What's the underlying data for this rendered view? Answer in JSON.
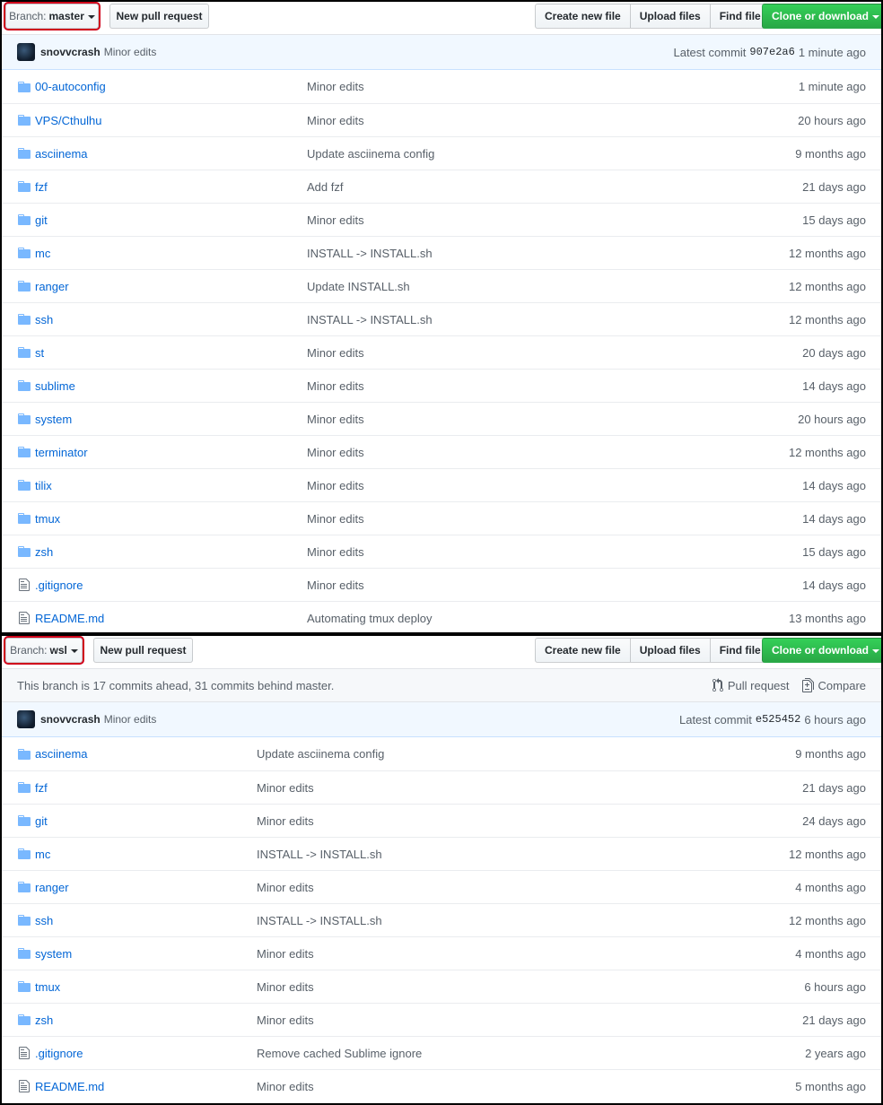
{
  "master": {
    "branch_label": "Branch:",
    "branch_value": "master",
    "new_pr": "New pull request",
    "create_file": "Create new file",
    "upload_files": "Upload files",
    "find_file": "Find file",
    "clone": "Clone or download",
    "commit": {
      "author": "snovvcrash",
      "message": "Minor edits",
      "latest_label": "Latest commit",
      "sha": "907e2a6",
      "time": "1 minute ago"
    },
    "rows": [
      {
        "type": "dir",
        "name": "00-autoconfig",
        "msg": "Minor edits",
        "age": "1 minute ago"
      },
      {
        "type": "dir",
        "name": "VPS/Cthulhu",
        "msg": "Minor edits",
        "age": "20 hours ago"
      },
      {
        "type": "dir",
        "name": "asciinema",
        "msg": "Update asciinema config",
        "age": "9 months ago"
      },
      {
        "type": "dir",
        "name": "fzf",
        "msg": "Add fzf",
        "age": "21 days ago"
      },
      {
        "type": "dir",
        "name": "git",
        "msg": "Minor edits",
        "age": "15 days ago"
      },
      {
        "type": "dir",
        "name": "mc",
        "msg": "INSTALL -> INSTALL.sh",
        "age": "12 months ago"
      },
      {
        "type": "dir",
        "name": "ranger",
        "msg": "Update INSTALL.sh",
        "age": "12 months ago"
      },
      {
        "type": "dir",
        "name": "ssh",
        "msg": "INSTALL -> INSTALL.sh",
        "age": "12 months ago"
      },
      {
        "type": "dir",
        "name": "st",
        "msg": "Minor edits",
        "age": "20 days ago"
      },
      {
        "type": "dir",
        "name": "sublime",
        "msg": "Minor edits",
        "age": "14 days ago"
      },
      {
        "type": "dir",
        "name": "system",
        "msg": "Minor edits",
        "age": "20 hours ago"
      },
      {
        "type": "dir",
        "name": "terminator",
        "msg": "Minor edits",
        "age": "12 months ago"
      },
      {
        "type": "dir",
        "name": "tilix",
        "msg": "Minor edits",
        "age": "14 days ago"
      },
      {
        "type": "dir",
        "name": "tmux",
        "msg": "Minor edits",
        "age": "14 days ago"
      },
      {
        "type": "dir",
        "name": "zsh",
        "msg": "Minor edits",
        "age": "15 days ago"
      },
      {
        "type": "file",
        "name": ".gitignore",
        "msg": "Minor edits",
        "age": "14 days ago"
      },
      {
        "type": "file",
        "name": "README.md",
        "msg": "Automating tmux deploy",
        "age": "13 months ago"
      }
    ]
  },
  "wsl": {
    "branch_label": "Branch:",
    "branch_value": "wsl",
    "new_pr": "New pull request",
    "create_file": "Create new file",
    "upload_files": "Upload files",
    "find_file": "Find file",
    "clone": "Clone or download",
    "branch_status": "This branch is 17 commits ahead, 31 commits behind master.",
    "pull_request": "Pull request",
    "compare": "Compare",
    "commit": {
      "author": "snovvcrash",
      "message": "Minor edits",
      "latest_label": "Latest commit",
      "sha": "e525452",
      "time": "6 hours ago"
    },
    "rows": [
      {
        "type": "dir",
        "name": "asciinema",
        "msg": "Update asciinema config",
        "age": "9 months ago"
      },
      {
        "type": "dir",
        "name": "fzf",
        "msg": "Minor edits",
        "age": "21 days ago"
      },
      {
        "type": "dir",
        "name": "git",
        "msg": "Minor edits",
        "age": "24 days ago"
      },
      {
        "type": "dir",
        "name": "mc",
        "msg": "INSTALL -> INSTALL.sh",
        "age": "12 months ago"
      },
      {
        "type": "dir",
        "name": "ranger",
        "msg": "Minor edits",
        "age": "4 months ago"
      },
      {
        "type": "dir",
        "name": "ssh",
        "msg": "INSTALL -> INSTALL.sh",
        "age": "12 months ago"
      },
      {
        "type": "dir",
        "name": "system",
        "msg": "Minor edits",
        "age": "4 months ago"
      },
      {
        "type": "dir",
        "name": "tmux",
        "msg": "Minor edits",
        "age": "6 hours ago"
      },
      {
        "type": "dir",
        "name": "zsh",
        "msg": "Minor edits",
        "age": "21 days ago"
      },
      {
        "type": "file",
        "name": ".gitignore",
        "msg": "Remove cached Sublime ignore",
        "age": "2 years ago"
      },
      {
        "type": "file",
        "name": "README.md",
        "msg": "Minor edits",
        "age": "5 months ago"
      }
    ]
  },
  "colors": {
    "link": "#0366d6",
    "folder": "#79b8ff",
    "green": "#28a745",
    "highlight": "#d0021b"
  }
}
